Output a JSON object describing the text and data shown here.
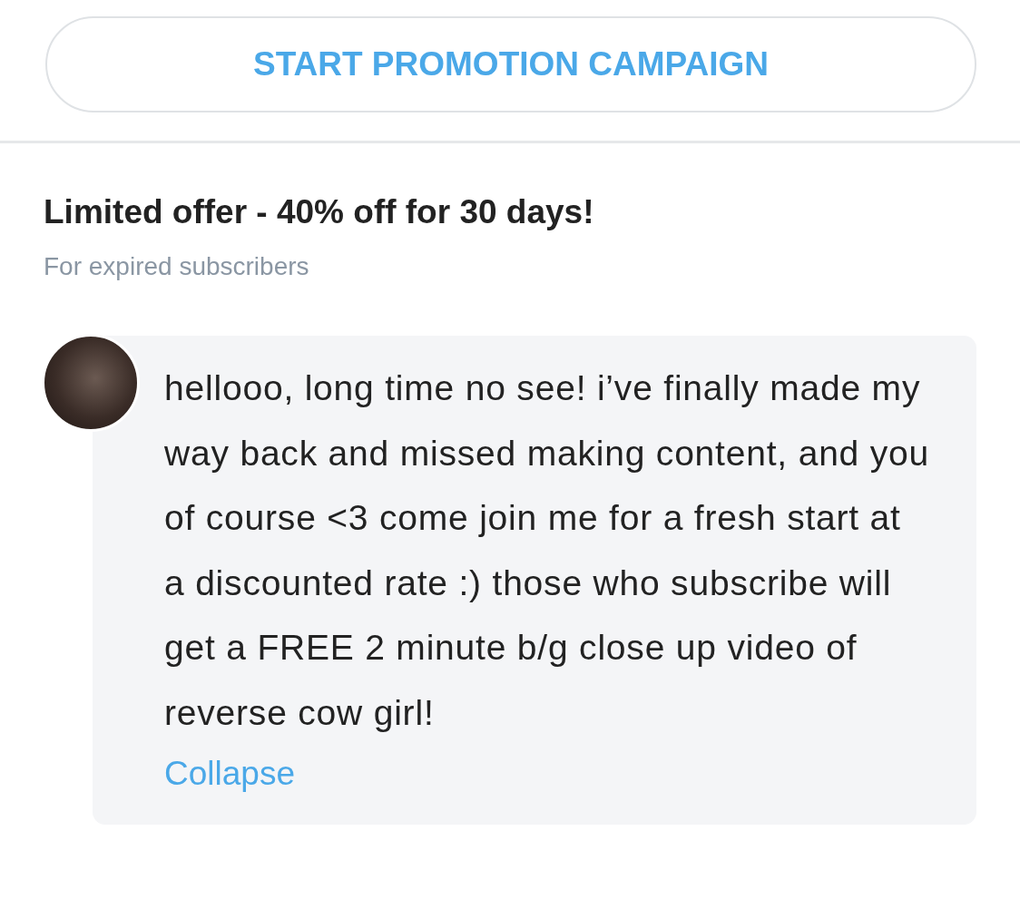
{
  "promo_button": {
    "label": "START PROMOTION CAMPAIGN"
  },
  "offer": {
    "title": "Limited offer - 40% off for 30 days!",
    "subtitle": "For expired subscribers"
  },
  "message": {
    "text": "hellooo, long time no see! i’ve finally made my way back and missed making content, and you of course <3 come join me for a fresh start at a discounted rate :) those who subscribe will get a FREE 2 minute b/g close up video of reverse cow girl!",
    "toggle_label": "Collapse"
  }
}
